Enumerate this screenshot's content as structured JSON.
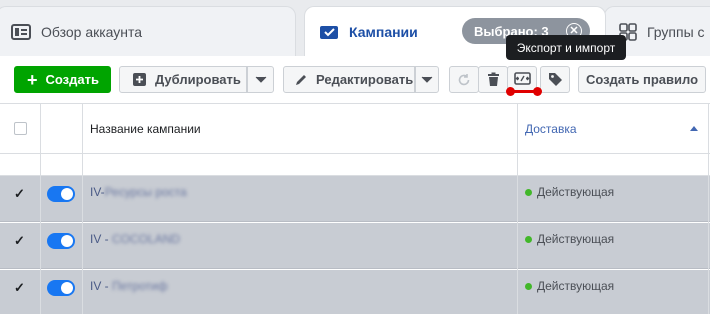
{
  "tabs": {
    "overview": {
      "label": "Обзор аккаунта",
      "icon": "account-overview-icon"
    },
    "campaigns": {
      "label": "Кампании",
      "icon": "campaign-folder-icon"
    },
    "groups": {
      "label": "Группы с",
      "icon": "ad-groups-icon"
    },
    "selected_pill": {
      "label": "Выбрано: 3",
      "close_icon": "close-icon"
    }
  },
  "tooltip": {
    "text": "Экспорт и импорт"
  },
  "toolbar": {
    "create_label": "Создать",
    "duplicate_label": "Дублировать",
    "edit_label": "Редактировать",
    "create_rule_label": "Создать правило",
    "icons": [
      "plus-icon",
      "duplicate-icon",
      "chevron-down-icon",
      "pencil-icon",
      "refresh-icon",
      "trash-icon",
      "export-import-icon",
      "tag-icon"
    ]
  },
  "table": {
    "columns": {
      "name": "Название кампании",
      "delivery": "Доставка"
    },
    "sort": "ascending",
    "rows": [
      {
        "name_prefix": "IV-",
        "name_hidden": "Ресурсы роста",
        "status": "Действующая",
        "checked": true,
        "enabled": true
      },
      {
        "name_prefix": "IV - ",
        "name_hidden": "COCOLAND",
        "status": "Действующая",
        "checked": true,
        "enabled": true
      },
      {
        "name_prefix": "IV - ",
        "name_hidden": "Петротиф",
        "status": "Действующая",
        "checked": true,
        "enabled": true
      }
    ]
  },
  "colors": {
    "accent": "#1877f2",
    "create_button": "#00a400",
    "selected_row": "#c8ccd3",
    "status_active": "#42b72a",
    "annotation_red": "#e00000"
  }
}
